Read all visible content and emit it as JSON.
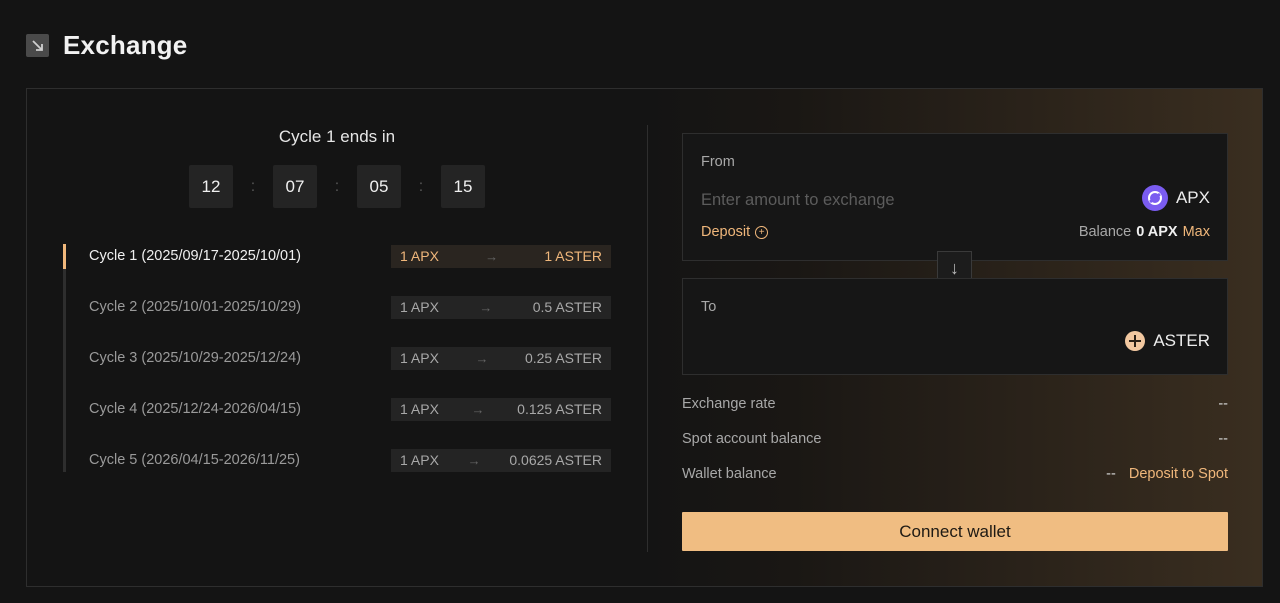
{
  "header": {
    "title": "Exchange",
    "icon": "arrow-down-right-icon"
  },
  "countdown": {
    "label": "Cycle 1 ends in",
    "values": [
      "12",
      "07",
      "05",
      "15"
    ],
    "separator": ":"
  },
  "cycles": [
    {
      "label": "Cycle 1 (2025/09/17-2025/10/01)",
      "from": "1 APX",
      "to": "1 ASTER",
      "active": true
    },
    {
      "label": "Cycle 2 (2025/10/01-2025/10/29)",
      "from": "1 APX",
      "to": "0.5 ASTER",
      "active": false
    },
    {
      "label": "Cycle 3 (2025/10/29-2025/12/24)",
      "from": "1 APX",
      "to": "0.25 ASTER",
      "active": false
    },
    {
      "label": "Cycle 4 (2025/12/24-2026/04/15)",
      "from": "1 APX",
      "to": "0.125 ASTER",
      "active": false
    },
    {
      "label": "Cycle 5 (2026/04/15-2026/11/25)",
      "from": "1 APX",
      "to": "0.0625 ASTER",
      "active": false
    }
  ],
  "arrow": "→",
  "from": {
    "label": "From",
    "placeholder": "Enter amount to exchange",
    "token": "APX",
    "deposit_label": "Deposit",
    "balance_label": "Balance",
    "balance_value": "0 APX",
    "max_label": "Max"
  },
  "swap_icon": "↓",
  "to": {
    "label": "To",
    "token": "ASTER"
  },
  "info": {
    "exchange_rate": {
      "label": "Exchange rate",
      "value": "--"
    },
    "spot_balance": {
      "label": "Spot account balance",
      "value": "--"
    },
    "wallet_balance": {
      "label": "Wallet balance",
      "value": "--",
      "link": "Deposit to Spot"
    }
  },
  "connect_button": "Connect wallet",
  "colors": {
    "accent": "#f0b77b",
    "button": "#f0bd82",
    "background": "#141414",
    "apx_logo": "#7a5cf0",
    "aster_logo": "#f2c8a0"
  }
}
